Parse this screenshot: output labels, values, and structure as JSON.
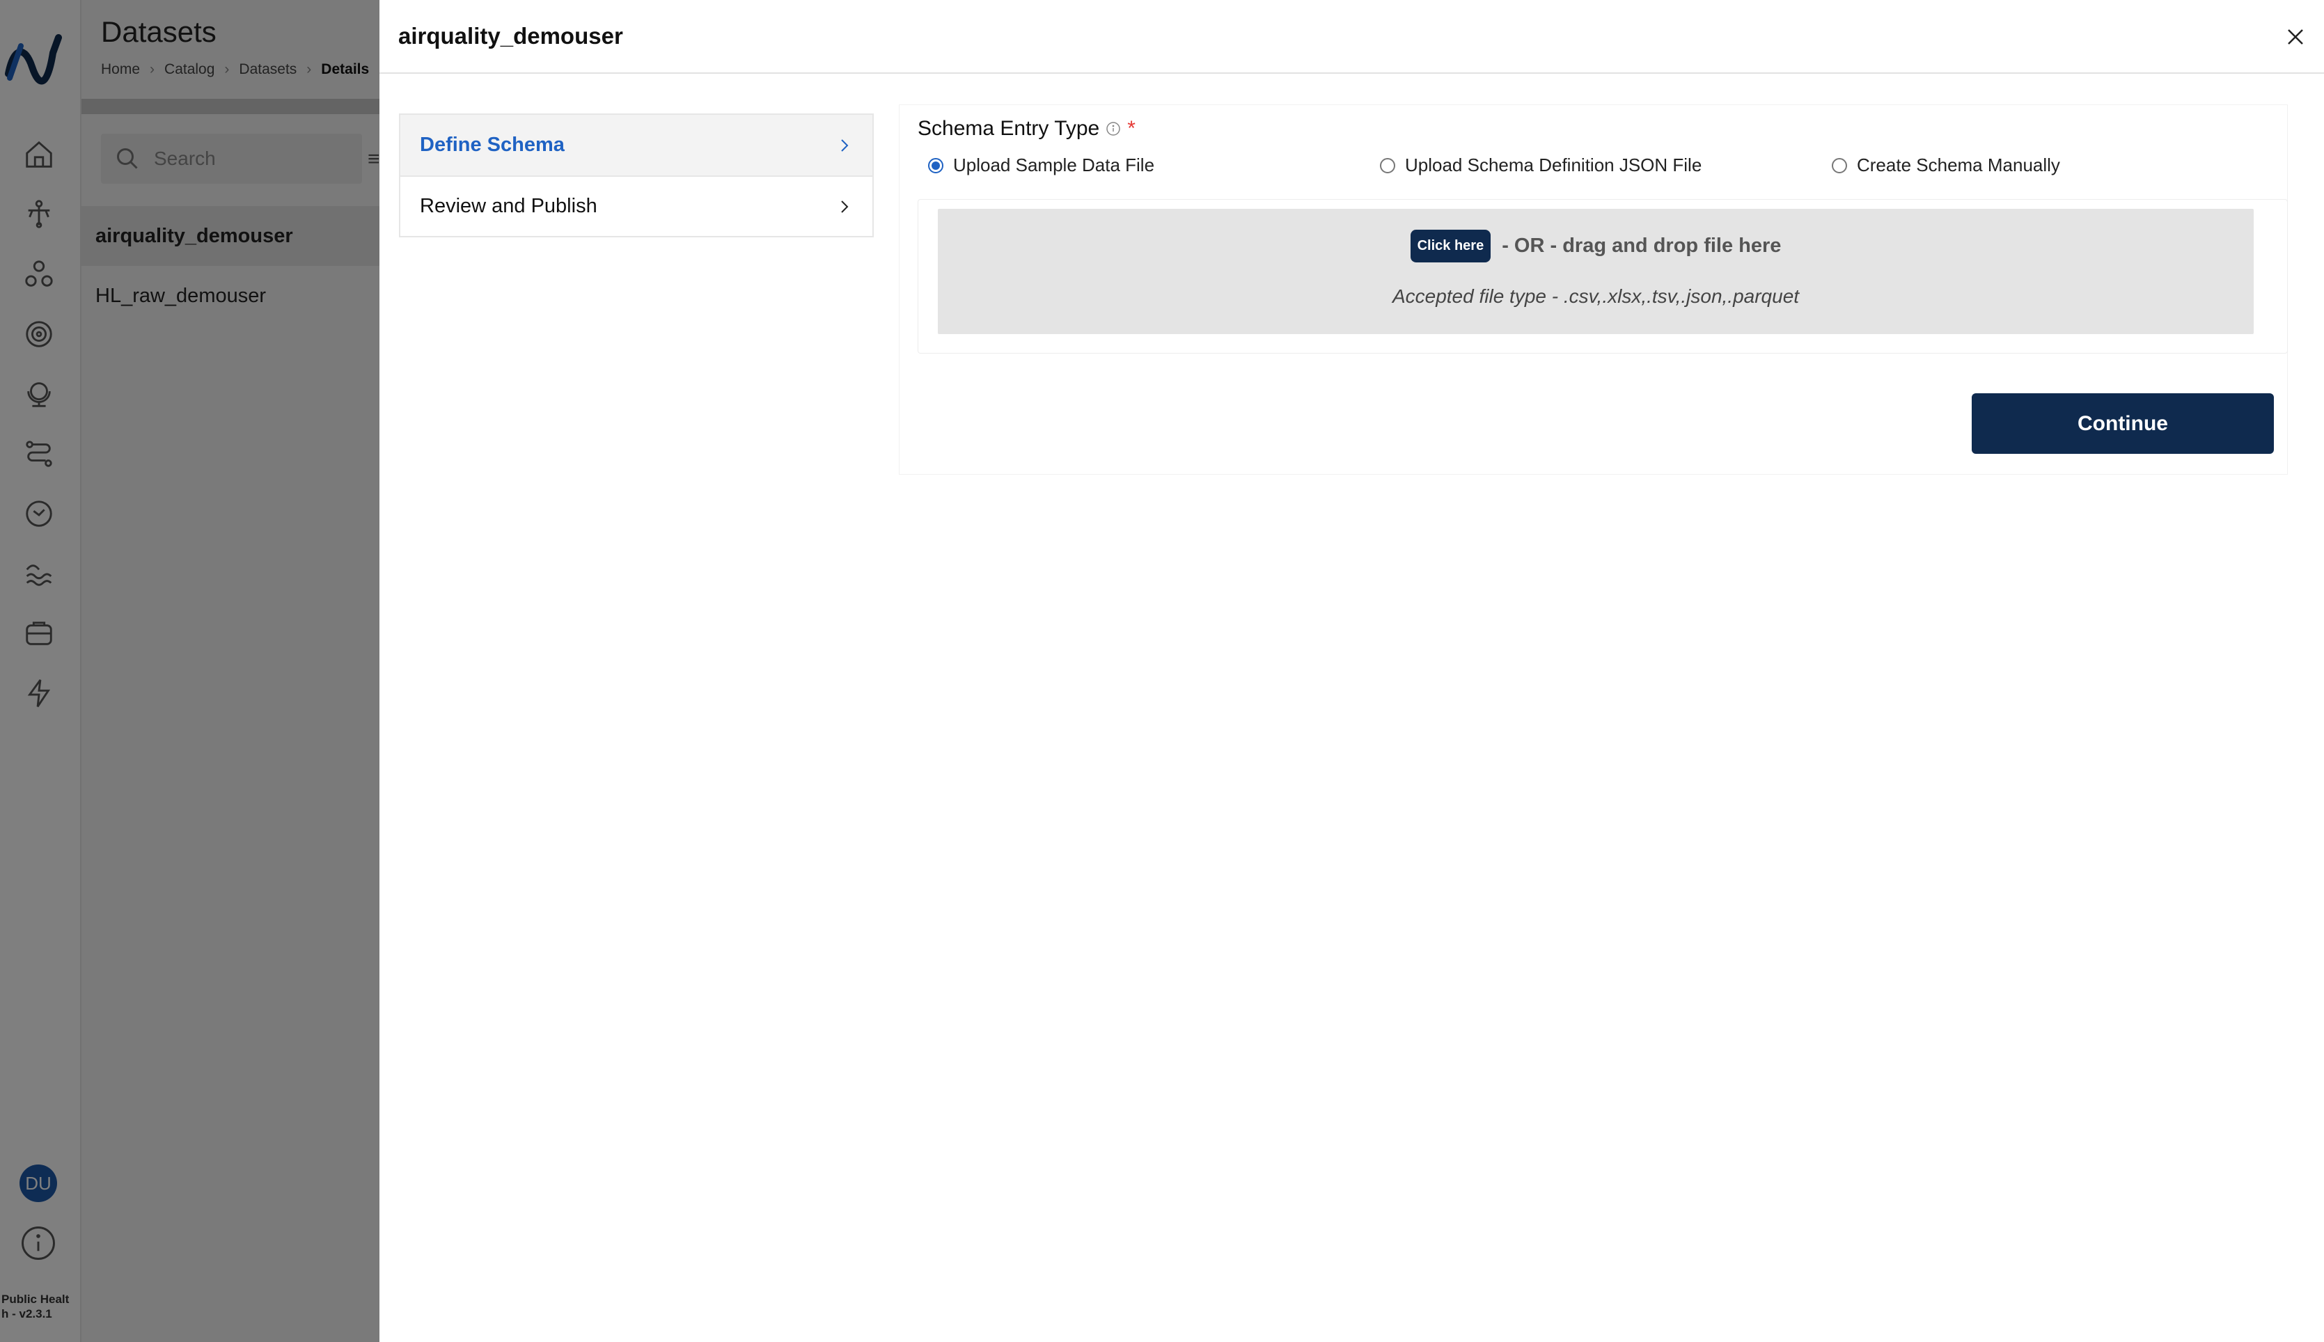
{
  "app": {
    "page_title": "Datasets",
    "breadcrumb": [
      "Home",
      "Catalog",
      "Datasets",
      "Details"
    ],
    "search_placeholder": "Search",
    "datasets": [
      "airquality_demouser",
      "HL_raw_demouser"
    ],
    "user_initials": "DU",
    "version": "Public Health - v2.3.1",
    "rail_icons": [
      "home-icon",
      "pipeline-icon",
      "nodes-icon",
      "target-icon",
      "globe-stand-icon",
      "route-icon",
      "clock-icon",
      "waves-icon",
      "archive-icon",
      "lightning-icon"
    ]
  },
  "drawer": {
    "title": "airquality_demouser",
    "steps": [
      {
        "label": "Define Schema",
        "active": true
      },
      {
        "label": "Review and Publish",
        "active": false
      }
    ],
    "schema_entry": {
      "label": "Schema Entry Type",
      "required_mark": "*",
      "options": [
        {
          "label": "Upload Sample Data File",
          "selected": true
        },
        {
          "label": "Upload Schema Definition JSON File",
          "selected": false
        },
        {
          "label": "Create Schema Manually",
          "selected": false
        }
      ]
    },
    "dropzone": {
      "click_label": "Click here",
      "drag_text": "- OR - drag and drop file here",
      "accepted_text": "Accepted file type - .csv,.xlsx,.tsv,.json,.parquet"
    },
    "continue_label": "Continue"
  },
  "colors": {
    "primary_navy": "#0f2a4e",
    "active_step_blue": "#1f62c3",
    "required_red": "#e53935",
    "avatar_blue": "#1c58a8"
  }
}
